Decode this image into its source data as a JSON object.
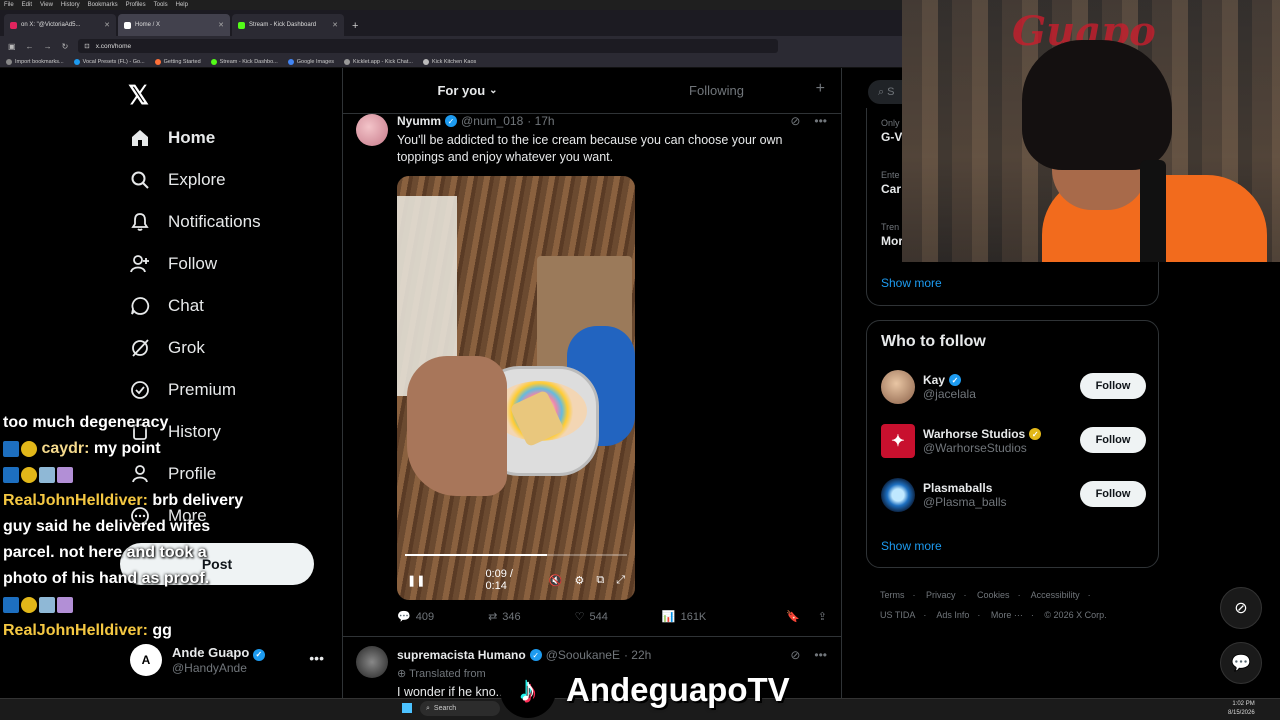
{
  "browser": {
    "menus": [
      "File",
      "Edit",
      "View",
      "History",
      "Bookmarks",
      "Profiles",
      "Tools",
      "Help"
    ],
    "tabs": [
      {
        "label": "on X: \"@VictoriaAd5...",
        "active": false,
        "color": "#e0245e"
      },
      {
        "label": "Home / X",
        "active": true,
        "color": "#000000"
      },
      {
        "label": "Stream - Kick Dashboard",
        "active": false,
        "color": "#53fc18"
      }
    ],
    "url": "x.com/home",
    "bookmarks": [
      "Import bookmarks...",
      "Vocal Presets (FL) - Go...",
      "Getting Started",
      "Stream - Kick Dashbo...",
      "Google Images",
      "Kicklet.app - Kick Chat...",
      "Kick Kitchen Kaos"
    ]
  },
  "nav": {
    "logo": "𝕏",
    "items": [
      {
        "label": "Home",
        "icon": "home-icon",
        "glyph": "⌂"
      },
      {
        "label": "Explore",
        "icon": "search-icon",
        "glyph": "⌕"
      },
      {
        "label": "Notifications",
        "icon": "bell-icon",
        "glyph": "🔔"
      },
      {
        "label": "Follow",
        "icon": "follow-icon",
        "glyph": "👤"
      },
      {
        "label": "Chat",
        "icon": "chat-icon",
        "glyph": "○"
      },
      {
        "label": "Grok",
        "icon": "grok-icon",
        "glyph": "⊘"
      },
      {
        "label": "Premium",
        "icon": "premium-icon",
        "glyph": "✪"
      },
      {
        "label": "History",
        "icon": "history-icon",
        "glyph": "▢"
      },
      {
        "label": "Profile",
        "icon": "profile-icon",
        "glyph": "👤"
      },
      {
        "label": "More",
        "icon": "more-icon",
        "glyph": "⋯"
      }
    ],
    "post_label": "Post",
    "account": {
      "name": "Ande Guapo",
      "handle": "@HandyAnde",
      "initial": "A"
    }
  },
  "chat": [
    {
      "text": "too much degeneracy"
    },
    {
      "user": "caydr:",
      "text": " my point"
    },
    {
      "user": "RealJohnHelldiver:",
      "text": " brb delivery guy said he delivered wifes parcel. not here and took a photo of his hand as proof."
    },
    {
      "user": "RealJohnHelldiver:",
      "text": " gg"
    }
  ],
  "timeline": {
    "tabs": [
      "For you",
      "Following"
    ],
    "plus": "+",
    "tweet1": {
      "name": "Nyumm",
      "handle": "@num_018",
      "time": "· 17h",
      "text": "You'll be addicted to the ice cream because you can choose your own toppings and enjoy whatever you want.",
      "video_time": "0:09 / 0:14",
      "video_progress": 0.64,
      "stats": {
        "replies": "409",
        "reposts": "346",
        "likes": "544",
        "views": "161K"
      }
    },
    "tweet2": {
      "name": "supremacista Humano",
      "handle": "@SooukaneE",
      "time": "· 22h",
      "translated": "Translated from",
      "text": "I wonder if he kno..."
    }
  },
  "sidebar": {
    "search_placeholder": "S",
    "trends": [
      {
        "ctx": "Only",
        "title": "G-V"
      },
      {
        "ctx": "Ente",
        "title": "Car"
      },
      {
        "ctx": "Tren",
        "title": "Mor"
      }
    ],
    "show_more": "Show more",
    "who_title": "Who to follow",
    "follows": [
      {
        "name": "Kay",
        "handle": "@jacelala",
        "badge": "blue",
        "color": "#c9a27a"
      },
      {
        "name": "Warhorse Studios",
        "handle": "@WarhorseStudios",
        "badge": "gold",
        "color": "#c8102e"
      },
      {
        "name": "Plasmaballs",
        "handle": "@Plasma_balls",
        "badge": "",
        "color": "#1d6fc0"
      }
    ],
    "follow_label": "Follow",
    "footer": [
      "Terms",
      "Privacy",
      "Cookies",
      "Accessibility",
      "US TIDA",
      "Ads Info",
      "More ···",
      "© 2026 X Corp."
    ]
  },
  "webcam": {
    "sign": "Guapo"
  },
  "watermark": {
    "text": "AndeguapoTV"
  },
  "taskbar": {
    "search": "Search",
    "time": "1:02 PM",
    "date": "8/15/2026"
  }
}
